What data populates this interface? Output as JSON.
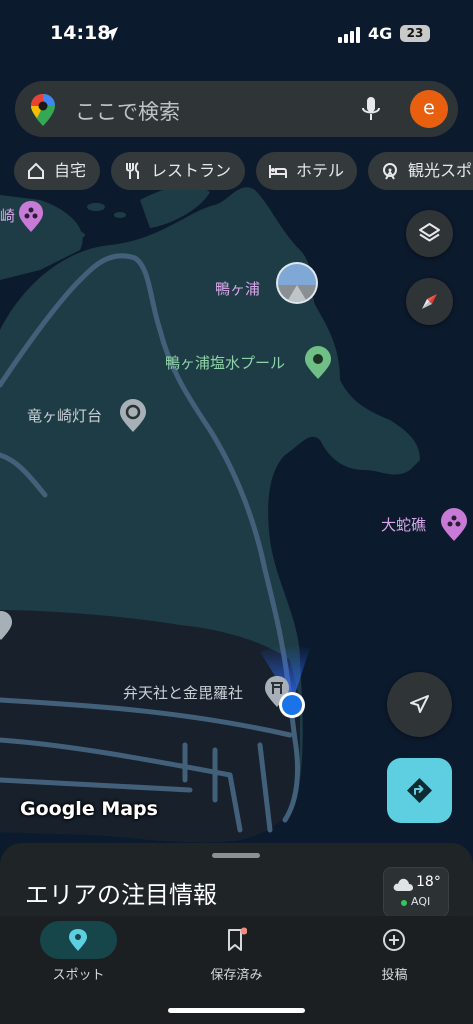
{
  "status_bar": {
    "time": "14:18",
    "network": "4G",
    "battery": "23"
  },
  "search": {
    "placeholder": "ここで検索",
    "avatar_letter": "e"
  },
  "chips": [
    {
      "label": "自宅",
      "icon": "home-icon"
    },
    {
      "label": "レストラン",
      "icon": "restaurant-icon"
    },
    {
      "label": "ホテル",
      "icon": "hotel-icon"
    },
    {
      "label": "観光スポ",
      "icon": "attraction-icon"
    }
  ],
  "map": {
    "places": [
      {
        "label": "鴨ヶ浦",
        "icon": "photo-pin-icon"
      },
      {
        "label": "鴨ヶ浦塩水プール",
        "icon": "park-pin-icon"
      },
      {
        "label": "竜ヶ崎灯台",
        "icon": "poi-pin-icon"
      },
      {
        "label": "大蛇礁",
        "icon": "attraction-pin-icon"
      },
      {
        "label": "弁天社と金毘羅社",
        "icon": "shrine-pin-icon"
      },
      {
        "label": "崎",
        "icon": "attraction-pin-icon"
      }
    ],
    "watermark": "Google Maps"
  },
  "sheet": {
    "title": "エリアの注目情報",
    "weather_temp": "18°",
    "aqi_label": "AQI"
  },
  "tabs": [
    {
      "label": "スポット",
      "icon": "pin-icon",
      "active": true
    },
    {
      "label": "保存済み",
      "icon": "bookmark-icon",
      "active": false
    },
    {
      "label": "投稿",
      "icon": "plus-circle-icon",
      "active": false
    }
  ],
  "colors": {
    "accent": "#5ecfe0",
    "avatar": "#e8600f",
    "location": "#1a73e8",
    "land": "#1d3b44",
    "water": "#0c1a2e"
  }
}
